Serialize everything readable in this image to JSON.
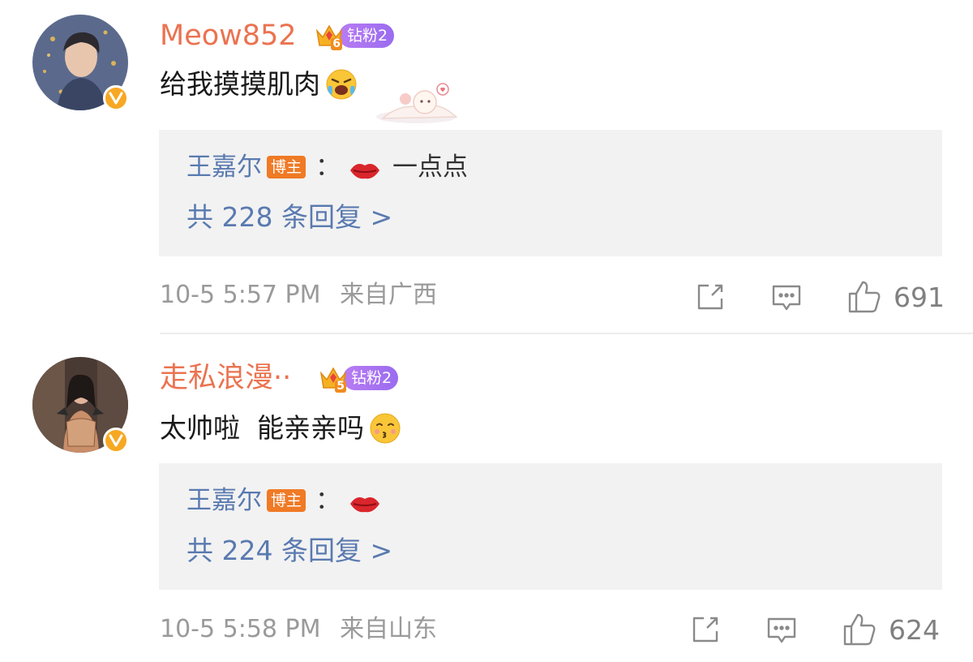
{
  "comments": [
    {
      "username": "Meow852",
      "fan_level": "6",
      "fan_badge": "钻粉2",
      "text": "给我摸摸肌肉",
      "emoji": "crying-laughing-emoji",
      "reply": {
        "author": "王嘉尔",
        "author_tag": "博主",
        "colon": "：",
        "text": "一点点",
        "count_label": "共 228 条回复 >"
      },
      "time": "10-5 5:57 PM",
      "location": "来自广西",
      "likes": "691"
    },
    {
      "username": "走私浪漫··",
      "fan_level": "5",
      "fan_badge": "钻粉2",
      "text": "太帅啦  能亲亲吗",
      "emoji": "kissing-emoji",
      "reply": {
        "author": "王嘉尔",
        "author_tag": "博主",
        "colon": "：",
        "text": "",
        "count_label": "共 224 条回复 >"
      },
      "time": "10-5 5:58 PM",
      "location": "来自山东",
      "likes": "624"
    }
  ],
  "icons": {
    "verified": "verified-v-icon",
    "share": "share-icon",
    "comment": "comment-icon",
    "like": "thumbs-up-icon",
    "lips": "kiss-lips-emoji"
  },
  "colors": {
    "username": "#eb7350",
    "link": "#5a7ab0",
    "reply_bg": "#f2f2f2",
    "host_tag": "#f07a25",
    "badge": "#f7a823",
    "fan_pill": "#a873f1"
  }
}
